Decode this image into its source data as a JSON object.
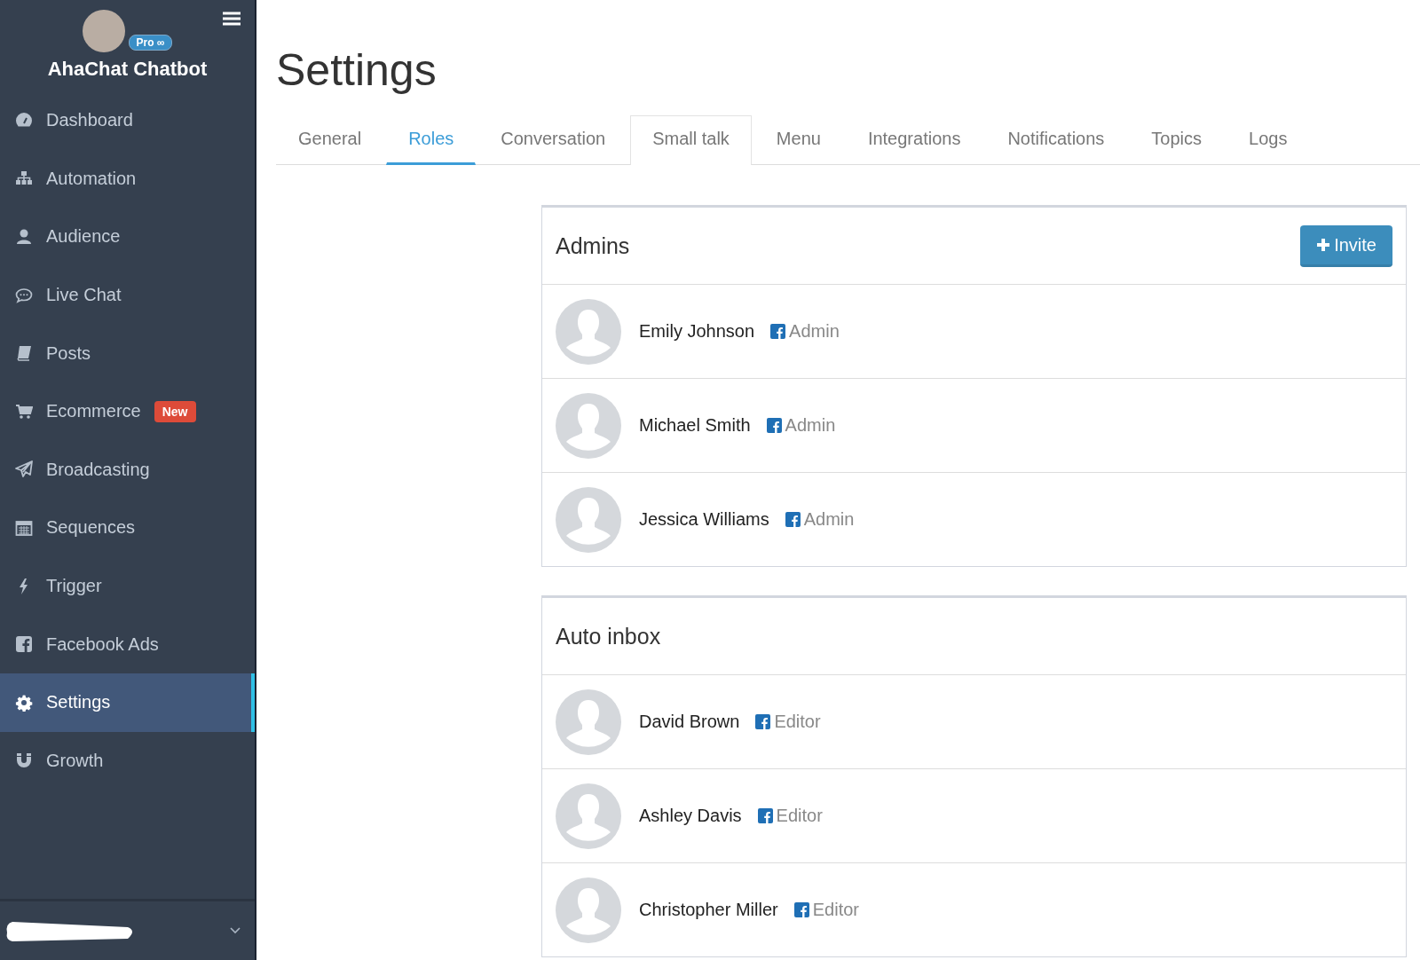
{
  "sidebar": {
    "brand": "AhaChat Chatbot",
    "plan_badge": "Pro ∞",
    "items": [
      {
        "label": "Dashboard",
        "selected": false
      },
      {
        "label": "Automation",
        "selected": false
      },
      {
        "label": "Audience",
        "selected": false
      },
      {
        "label": "Live Chat",
        "selected": false
      },
      {
        "label": "Posts",
        "selected": false
      },
      {
        "label": "Ecommerce",
        "selected": false,
        "badge": "New"
      },
      {
        "label": "Broadcasting",
        "selected": false
      },
      {
        "label": "Sequences",
        "selected": false
      },
      {
        "label": "Trigger",
        "selected": false
      },
      {
        "label": "Facebook Ads",
        "selected": false
      },
      {
        "label": "Settings",
        "selected": true
      },
      {
        "label": "Growth",
        "selected": false
      }
    ]
  },
  "page_title": "Settings",
  "tabs": [
    {
      "label": "General",
      "selected": false,
      "hovered": false
    },
    {
      "label": "Roles",
      "selected": true,
      "hovered": false
    },
    {
      "label": "Conversation",
      "selected": false,
      "hovered": false
    },
    {
      "label": "Small talk",
      "selected": false,
      "hovered": true
    },
    {
      "label": "Menu",
      "selected": false,
      "hovered": false
    },
    {
      "label": "Integrations",
      "selected": false,
      "hovered": false
    },
    {
      "label": "Notifications",
      "selected": false,
      "hovered": false
    },
    {
      "label": "Topics",
      "selected": false,
      "hovered": false
    },
    {
      "label": "Logs",
      "selected": false,
      "hovered": false
    }
  ],
  "panels": [
    {
      "title": "Admins",
      "button": "Invite",
      "members": [
        {
          "name": "Emily Johnson",
          "role": "Admin"
        },
        {
          "name": "Michael Smith",
          "role": "Admin"
        },
        {
          "name": "Jessica Williams",
          "role": "Admin"
        }
      ]
    },
    {
      "title": "Auto inbox",
      "members": [
        {
          "name": "David Brown",
          "role": "Editor"
        },
        {
          "name": "Ashley Davis",
          "role": "Editor"
        },
        {
          "name": "Christopher Miller",
          "role": "Editor"
        }
      ]
    }
  ]
}
